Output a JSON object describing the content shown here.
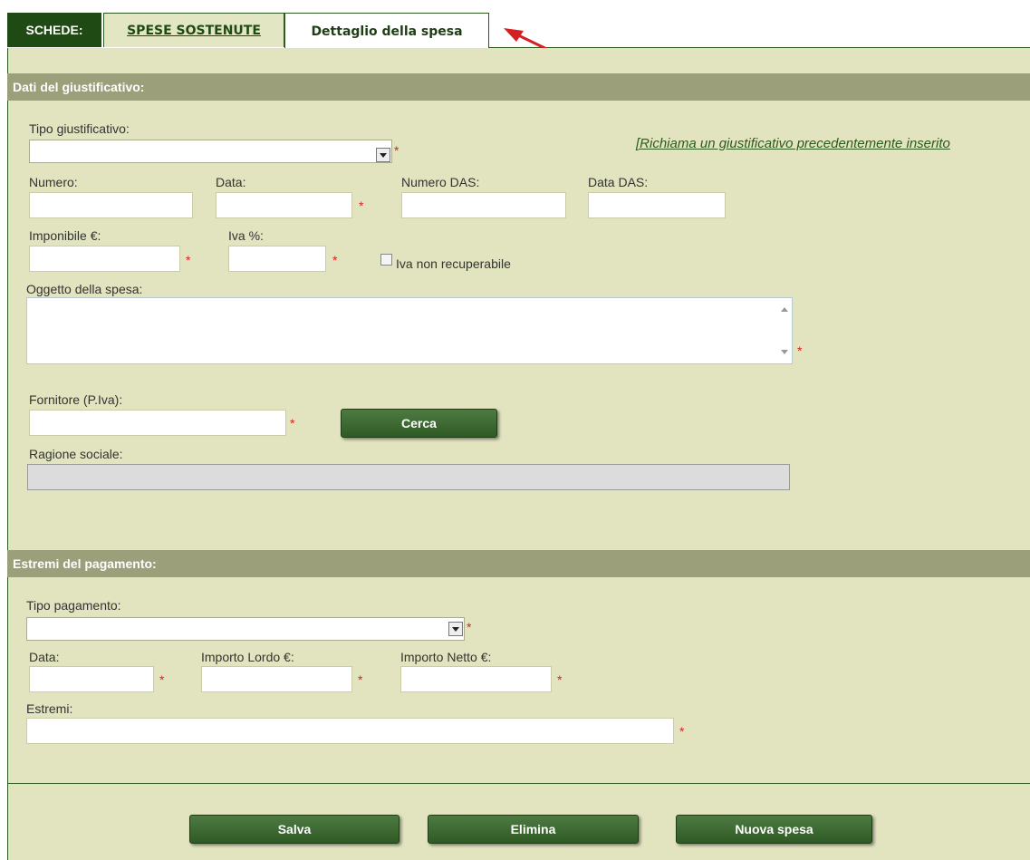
{
  "tabs": {
    "label": "SCHEDE:",
    "list_tab": "SPESE SOSTENUTE",
    "detail_tab": "Dettaglio della spesa"
  },
  "section_justification": {
    "title": "Dati del giustificativo:",
    "tipo_label": "Tipo giustificativo:",
    "tipo_value": "",
    "recall_link": "[Richiama un giustificativo precedentemente inserito",
    "numero_label": "Numero:",
    "data_label": "Data:",
    "numero_das_label": "Numero DAS:",
    "data_das_label": "Data DAS:",
    "imponibile_label": "Imponibile €:",
    "iva_label": "Iva %:",
    "iva_non_recuperabile_label": "Iva non recuperabile",
    "oggetto_label": "Oggetto della spesa:",
    "fornitore_label": "Fornitore (P.Iva):",
    "cerca_label": "Cerca",
    "ragione_sociale_label": "Ragione sociale:"
  },
  "section_payment": {
    "title": "Estremi del pagamento:",
    "tipo_label": "Tipo pagamento:",
    "tipo_value": "",
    "data_label": "Data:",
    "importo_lordo_label": "Importo Lordo €:",
    "importo_netto_label": "Importo Netto €:",
    "estremi_label": "Estremi:"
  },
  "required_marker": "*",
  "actions": {
    "save": "Salva",
    "delete": "Elimina",
    "new": "Nuova spesa"
  },
  "colors": {
    "accent": "#2c5a1e",
    "panel_bg": "#e1e4bf",
    "section_bar": "#9b9f7a",
    "required": "#e02020",
    "annotation_arrow": "#d42020"
  }
}
